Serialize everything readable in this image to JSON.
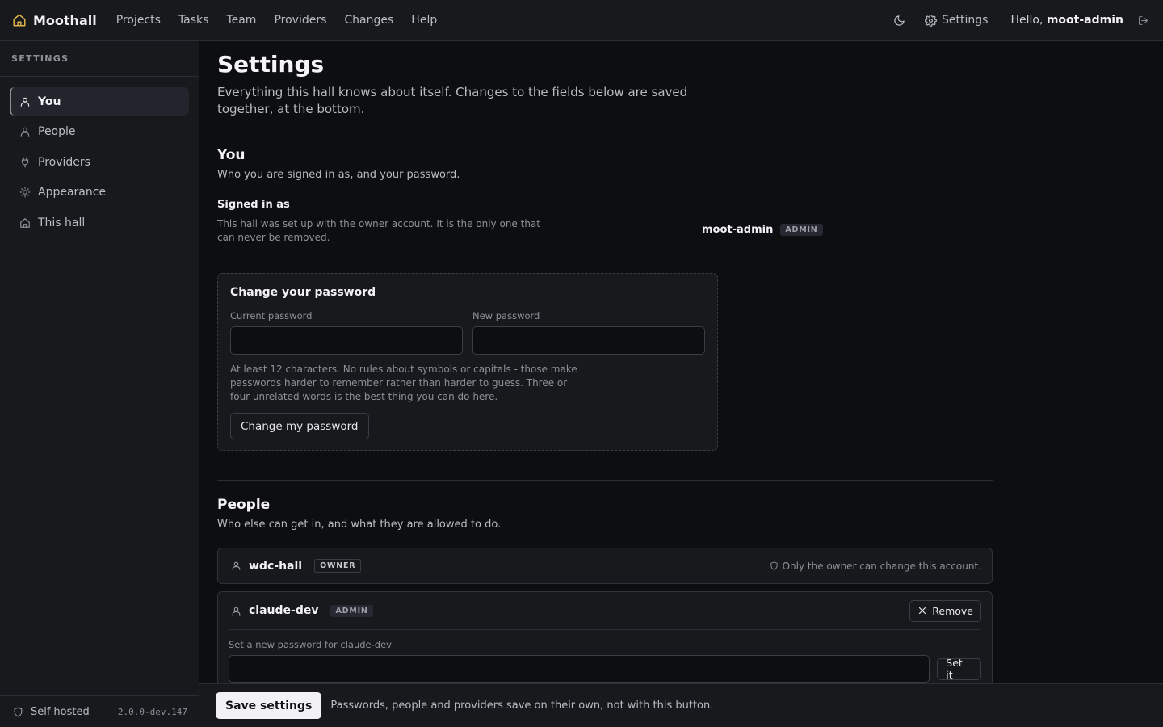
{
  "app": {
    "name": "Moothall",
    "nav": [
      "Projects",
      "Tasks",
      "Team",
      "Providers",
      "Changes",
      "Help"
    ],
    "settings_label": "Settings",
    "greeting": "Hello,",
    "username": "moot-admin",
    "icons": [
      "home-logo-icon",
      "moon-icon",
      "gear-icon",
      "logout-icon"
    ],
    "accent_color": "#e0b24a"
  },
  "sidebar": {
    "heading": "SETTINGS",
    "items": [
      {
        "label": "You",
        "icon": "user-icon",
        "active": true
      },
      {
        "label": "People",
        "icon": "user-icon"
      },
      {
        "label": "Providers",
        "icon": "plug-icon"
      },
      {
        "label": "Appearance",
        "icon": "sun-icon"
      },
      {
        "label": "This hall",
        "icon": "home-icon"
      }
    ],
    "footer_label": "Self-hosted",
    "version": "2.0.0-dev.147"
  },
  "page": {
    "title": "Settings",
    "subtitle": "Everything this hall knows about itself. Changes to the fields below are saved together, at the bottom."
  },
  "you": {
    "title": "You",
    "subtitle": "Who you are signed in as, and your password.",
    "signed_label": "Signed in as",
    "signed_help": "This hall was set up with the owner account. It is the only one that can never be removed.",
    "signed_name": "moot-admin",
    "signed_badge": "ADMIN"
  },
  "password": {
    "title": "Change your password",
    "current_label": "Current password",
    "new_label": "New password",
    "current_value": "",
    "new_value": "",
    "help": "At least 12 characters. No rules about symbols or capitals - those make passwords harder to remember rather than harder to guess. Three or four unrelated words is the best thing you can do here.",
    "button": "Change my password"
  },
  "people": {
    "title": "People",
    "subtitle": "Who else can get in, and what they are allowed to do.",
    "members": [
      {
        "name": "wdc-hall",
        "badge": "OWNER",
        "note": "Only the owner can change this account."
      },
      {
        "name": "claude-dev",
        "badge": "ADMIN",
        "remove": "Remove",
        "pw_label": "Set a new password for claude-dev",
        "pw_value": "",
        "set_button": "Set it"
      }
    ]
  },
  "savebar": {
    "button": "Save settings",
    "note": "Passwords, people and providers save on their own, not with this button."
  }
}
